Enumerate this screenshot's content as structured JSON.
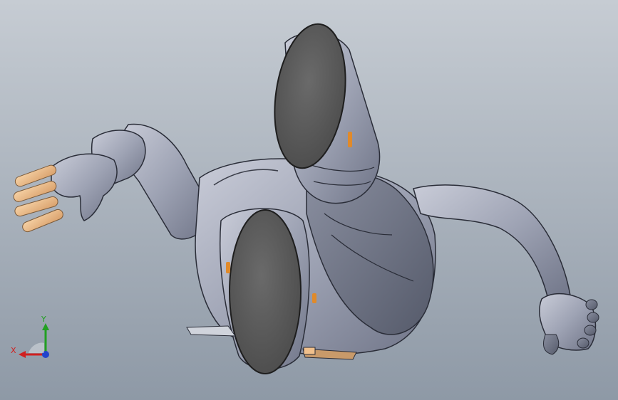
{
  "viewport": {
    "background_top": "#c6ccd3",
    "background_bottom": "#8e99a6",
    "body_color": "#9ea3b4",
    "body_dark": "#5f6474",
    "sole_color": "#5a5a5a",
    "skin_color": "#f0c08c",
    "accent_orange": "#e08a2a"
  },
  "triad": {
    "x_label": "X",
    "y_label": "Y",
    "x_color": "#d02020",
    "y_color": "#22a022",
    "z_color": "#2244cc"
  }
}
